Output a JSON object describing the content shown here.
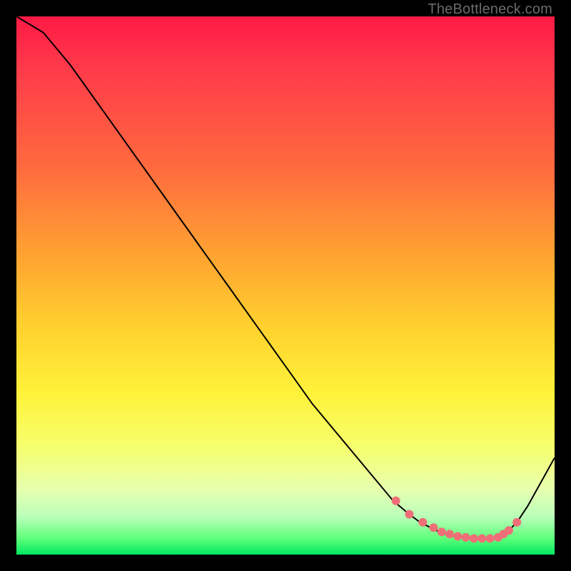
{
  "attribution": "TheBottleneck.com",
  "colors": {
    "curve_stroke": "#000000",
    "marker_fill": "#ef6f78",
    "marker_stroke": "#ef6f78"
  },
  "chart_data": {
    "type": "line",
    "title": "",
    "xlabel": "",
    "ylabel": "",
    "xlim": [
      0,
      100
    ],
    "ylim": [
      0,
      100
    ],
    "series": [
      {
        "name": "curve",
        "x": [
          0,
          5,
          10,
          15,
          20,
          25,
          30,
          35,
          40,
          45,
          50,
          55,
          60,
          65,
          70,
          73,
          75,
          77,
          79,
          81,
          83,
          85,
          87,
          89,
          91,
          93,
          95,
          100
        ],
        "y": [
          100,
          97,
          91,
          84,
          77,
          70,
          63,
          56,
          49,
          42,
          35,
          28,
          22,
          16,
          10,
          7.5,
          6.0,
          5.0,
          4.0,
          3.5,
          3.2,
          3.0,
          3.0,
          3.2,
          4.0,
          6.0,
          9.0,
          18
        ]
      }
    ],
    "markers": {
      "name": "highlight-points",
      "x": [
        70.5,
        73.0,
        75.5,
        77.5,
        79.0,
        80.5,
        82.0,
        83.5,
        85.0,
        86.5,
        88.0,
        89.5,
        90.5,
        91.5,
        93.0
      ],
      "y": [
        10.0,
        7.5,
        6.0,
        5.0,
        4.2,
        3.8,
        3.4,
        3.2,
        3.0,
        3.0,
        3.0,
        3.2,
        3.8,
        4.5,
        6.0
      ]
    }
  }
}
